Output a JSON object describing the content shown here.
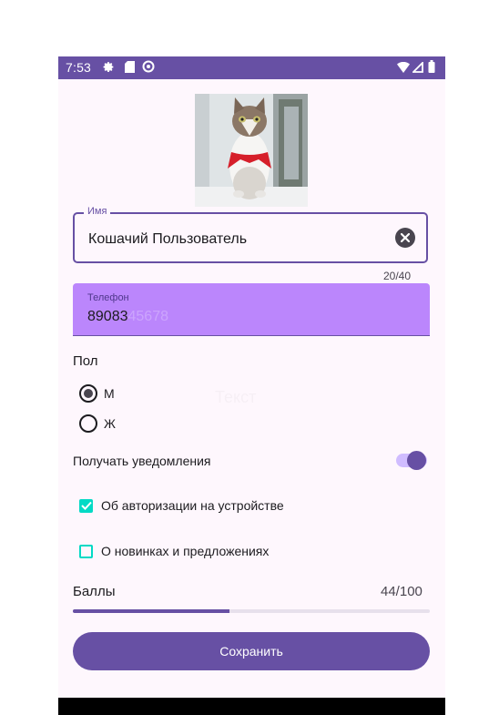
{
  "status_bar": {
    "time": "7:53",
    "left_icons": [
      "settings-icon",
      "sim-card-icon",
      "sync-icon"
    ],
    "right_icons": [
      "wifi-icon",
      "signal-icon",
      "battery-icon"
    ]
  },
  "profile": {
    "photo_icon": "cat-photo"
  },
  "name_field": {
    "label": "Имя",
    "value": "Кошачий Пользователь",
    "counter": "20/40",
    "clear_icon": "clear-icon"
  },
  "phone_field": {
    "label": "Телефон",
    "value": "89083",
    "placeholder_ghost": "45678"
  },
  "ghost_text": "Текст",
  "gender": {
    "title": "Пол",
    "options": [
      {
        "label": "М",
        "selected": true
      },
      {
        "label": "Ж",
        "selected": false
      }
    ]
  },
  "notifications": {
    "label": "Получать уведомления",
    "enabled": true
  },
  "checkboxes": [
    {
      "label": "Об авторизации на устройстве",
      "checked": true
    },
    {
      "label": "О новинках и предложениях",
      "checked": false
    }
  ],
  "points": {
    "label": "Баллы",
    "value_text": "44/100",
    "fraction": 0.44
  },
  "save_button": {
    "label": "Сохранить"
  },
  "colors": {
    "primary": "#6750a4",
    "phone_bg": "#bb86fc",
    "checkbox": "#03dac5",
    "background": "#fef7fd"
  }
}
